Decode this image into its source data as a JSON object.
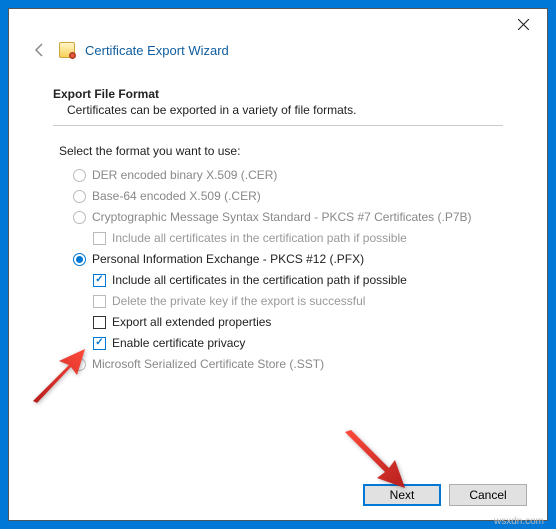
{
  "window": {
    "title": "Certificate Export Wizard"
  },
  "section": {
    "title": "Export File Format",
    "desc": "Certificates can be exported in a variety of file formats."
  },
  "instruction": "Select the format you want to use:",
  "options": {
    "der": "DER encoded binary X.509 (.CER)",
    "base64": "Base-64 encoded X.509 (.CER)",
    "pkcs7": "Cryptographic Message Syntax Standard - PKCS #7 Certificates (.P7B)",
    "pkcs7_include": "Include all certificates in the certification path if possible",
    "pfx": "Personal Information Exchange - PKCS #12 (.PFX)",
    "pfx_include": "Include all certificates in the certification path if possible",
    "pfx_delete": "Delete the private key if the export is successful",
    "pfx_extended": "Export all extended properties",
    "pfx_privacy": "Enable certificate privacy",
    "sst": "Microsoft Serialized Certificate Store (.SST)"
  },
  "buttons": {
    "next": "Next",
    "cancel": "Cancel"
  },
  "watermark": "wsxdn.com"
}
